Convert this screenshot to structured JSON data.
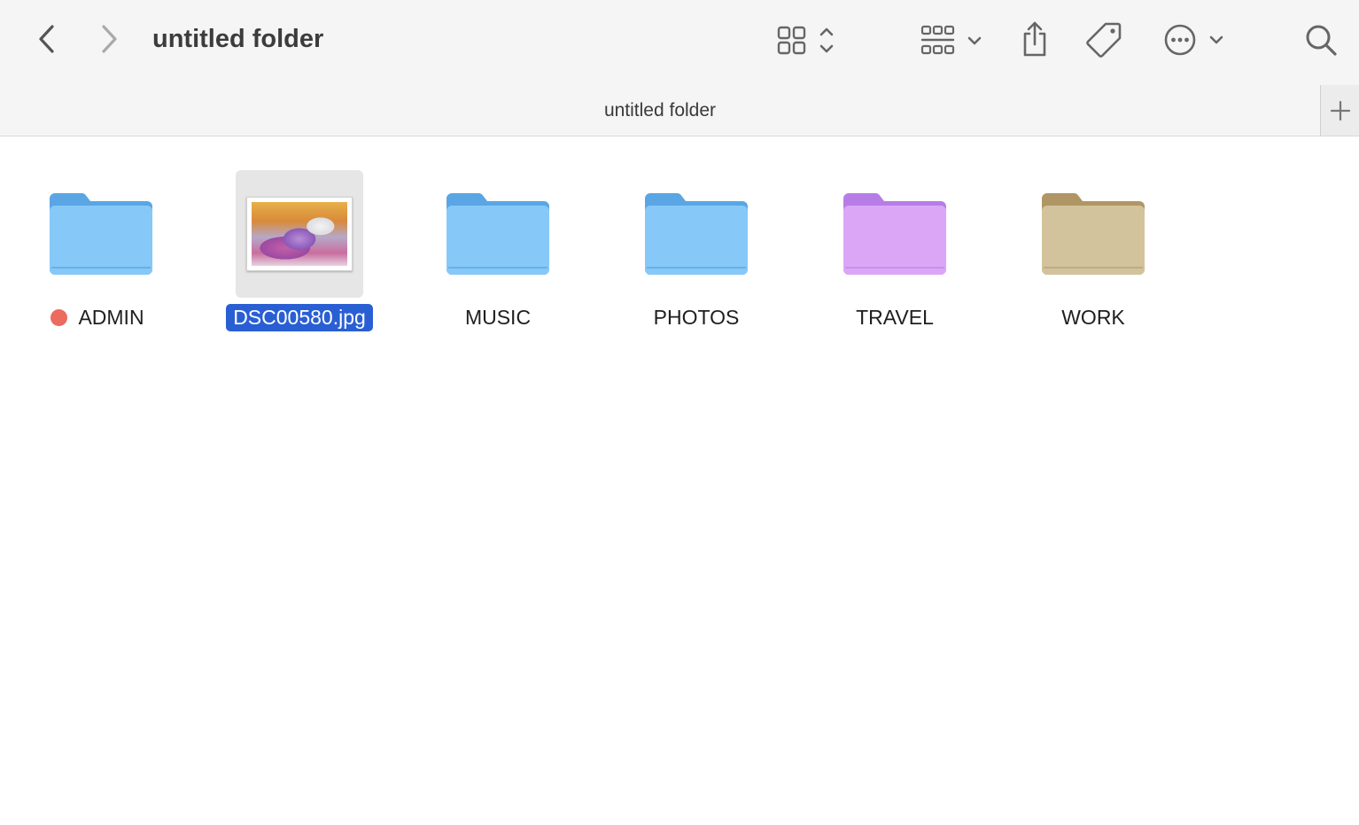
{
  "window": {
    "title": "untitled folder"
  },
  "toolbar": {
    "icons": {
      "back": "chevron-left-icon",
      "forward": "chevron-right-icon",
      "view": "grid-view-icon",
      "group": "group-by-icon",
      "share": "share-icon",
      "tag": "tag-icon",
      "more": "ellipsis-circle-icon",
      "search": "search-icon"
    }
  },
  "tabbar": {
    "tab_title": "untitled folder",
    "new_tab_icon": "plus-icon"
  },
  "items": [
    {
      "name": "ADMIN",
      "kind": "folder",
      "color": "#7ec3f5",
      "tag_color": "#ec6a5e",
      "selected": false
    },
    {
      "name": "DSC00580.jpg",
      "kind": "image",
      "selected": true
    },
    {
      "name": "MUSIC",
      "kind": "folder",
      "color": "#7ec3f5",
      "selected": false
    },
    {
      "name": "PHOTOS",
      "kind": "folder",
      "color": "#7ec3f5",
      "selected": false
    },
    {
      "name": "TRAVEL",
      "kind": "folder",
      "color": "#d9a3f5",
      "selected": false
    },
    {
      "name": "WORK",
      "kind": "folder",
      "color": "#cfc09a",
      "selected": false
    }
  ],
  "colors": {
    "selection": "#2a5fd4",
    "toolbar_bg": "#f5f5f5",
    "icon_gray": "#6e6e6e"
  }
}
